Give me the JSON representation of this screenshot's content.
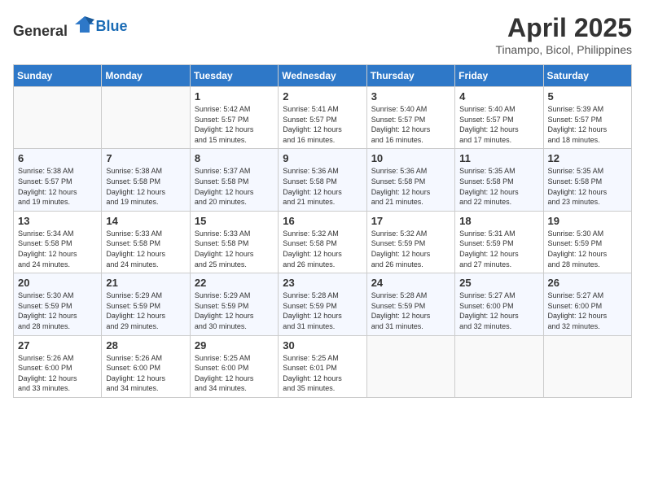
{
  "header": {
    "logo_general": "General",
    "logo_blue": "Blue",
    "month": "April 2025",
    "location": "Tinampo, Bicol, Philippines"
  },
  "weekdays": [
    "Sunday",
    "Monday",
    "Tuesday",
    "Wednesday",
    "Thursday",
    "Friday",
    "Saturday"
  ],
  "weeks": [
    [
      {
        "day": "",
        "info": ""
      },
      {
        "day": "",
        "info": ""
      },
      {
        "day": "1",
        "info": "Sunrise: 5:42 AM\nSunset: 5:57 PM\nDaylight: 12 hours\nand 15 minutes."
      },
      {
        "day": "2",
        "info": "Sunrise: 5:41 AM\nSunset: 5:57 PM\nDaylight: 12 hours\nand 16 minutes."
      },
      {
        "day": "3",
        "info": "Sunrise: 5:40 AM\nSunset: 5:57 PM\nDaylight: 12 hours\nand 16 minutes."
      },
      {
        "day": "4",
        "info": "Sunrise: 5:40 AM\nSunset: 5:57 PM\nDaylight: 12 hours\nand 17 minutes."
      },
      {
        "day": "5",
        "info": "Sunrise: 5:39 AM\nSunset: 5:57 PM\nDaylight: 12 hours\nand 18 minutes."
      }
    ],
    [
      {
        "day": "6",
        "info": "Sunrise: 5:38 AM\nSunset: 5:57 PM\nDaylight: 12 hours\nand 19 minutes."
      },
      {
        "day": "7",
        "info": "Sunrise: 5:38 AM\nSunset: 5:58 PM\nDaylight: 12 hours\nand 19 minutes."
      },
      {
        "day": "8",
        "info": "Sunrise: 5:37 AM\nSunset: 5:58 PM\nDaylight: 12 hours\nand 20 minutes."
      },
      {
        "day": "9",
        "info": "Sunrise: 5:36 AM\nSunset: 5:58 PM\nDaylight: 12 hours\nand 21 minutes."
      },
      {
        "day": "10",
        "info": "Sunrise: 5:36 AM\nSunset: 5:58 PM\nDaylight: 12 hours\nand 21 minutes."
      },
      {
        "day": "11",
        "info": "Sunrise: 5:35 AM\nSunset: 5:58 PM\nDaylight: 12 hours\nand 22 minutes."
      },
      {
        "day": "12",
        "info": "Sunrise: 5:35 AM\nSunset: 5:58 PM\nDaylight: 12 hours\nand 23 minutes."
      }
    ],
    [
      {
        "day": "13",
        "info": "Sunrise: 5:34 AM\nSunset: 5:58 PM\nDaylight: 12 hours\nand 24 minutes."
      },
      {
        "day": "14",
        "info": "Sunrise: 5:33 AM\nSunset: 5:58 PM\nDaylight: 12 hours\nand 24 minutes."
      },
      {
        "day": "15",
        "info": "Sunrise: 5:33 AM\nSunset: 5:58 PM\nDaylight: 12 hours\nand 25 minutes."
      },
      {
        "day": "16",
        "info": "Sunrise: 5:32 AM\nSunset: 5:58 PM\nDaylight: 12 hours\nand 26 minutes."
      },
      {
        "day": "17",
        "info": "Sunrise: 5:32 AM\nSunset: 5:59 PM\nDaylight: 12 hours\nand 26 minutes."
      },
      {
        "day": "18",
        "info": "Sunrise: 5:31 AM\nSunset: 5:59 PM\nDaylight: 12 hours\nand 27 minutes."
      },
      {
        "day": "19",
        "info": "Sunrise: 5:30 AM\nSunset: 5:59 PM\nDaylight: 12 hours\nand 28 minutes."
      }
    ],
    [
      {
        "day": "20",
        "info": "Sunrise: 5:30 AM\nSunset: 5:59 PM\nDaylight: 12 hours\nand 28 minutes."
      },
      {
        "day": "21",
        "info": "Sunrise: 5:29 AM\nSunset: 5:59 PM\nDaylight: 12 hours\nand 29 minutes."
      },
      {
        "day": "22",
        "info": "Sunrise: 5:29 AM\nSunset: 5:59 PM\nDaylight: 12 hours\nand 30 minutes."
      },
      {
        "day": "23",
        "info": "Sunrise: 5:28 AM\nSunset: 5:59 PM\nDaylight: 12 hours\nand 31 minutes."
      },
      {
        "day": "24",
        "info": "Sunrise: 5:28 AM\nSunset: 5:59 PM\nDaylight: 12 hours\nand 31 minutes."
      },
      {
        "day": "25",
        "info": "Sunrise: 5:27 AM\nSunset: 6:00 PM\nDaylight: 12 hours\nand 32 minutes."
      },
      {
        "day": "26",
        "info": "Sunrise: 5:27 AM\nSunset: 6:00 PM\nDaylight: 12 hours\nand 32 minutes."
      }
    ],
    [
      {
        "day": "27",
        "info": "Sunrise: 5:26 AM\nSunset: 6:00 PM\nDaylight: 12 hours\nand 33 minutes."
      },
      {
        "day": "28",
        "info": "Sunrise: 5:26 AM\nSunset: 6:00 PM\nDaylight: 12 hours\nand 34 minutes."
      },
      {
        "day": "29",
        "info": "Sunrise: 5:25 AM\nSunset: 6:00 PM\nDaylight: 12 hours\nand 34 minutes."
      },
      {
        "day": "30",
        "info": "Sunrise: 5:25 AM\nSunset: 6:01 PM\nDaylight: 12 hours\nand 35 minutes."
      },
      {
        "day": "",
        "info": ""
      },
      {
        "day": "",
        "info": ""
      },
      {
        "day": "",
        "info": ""
      }
    ]
  ]
}
